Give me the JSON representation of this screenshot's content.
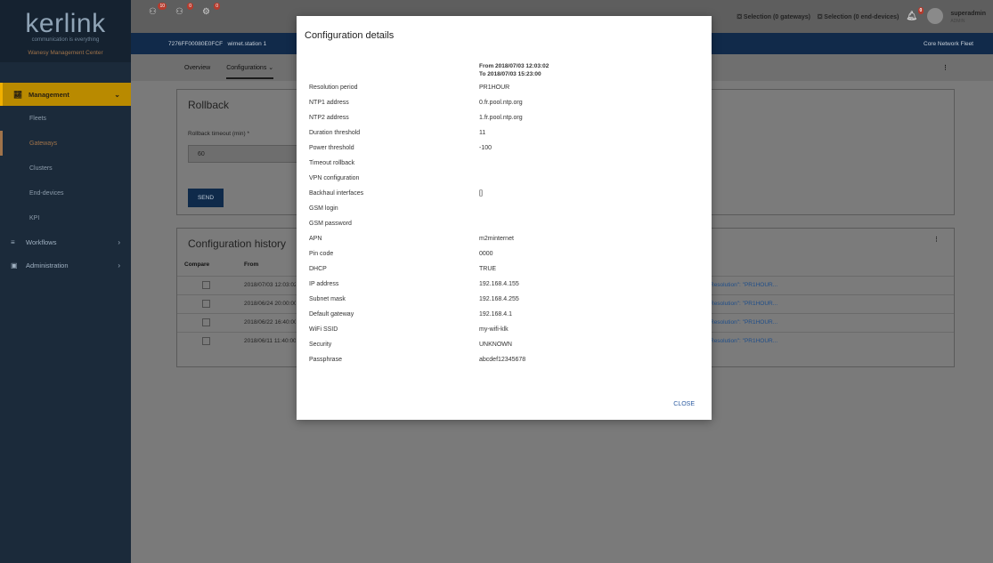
{
  "brand": {
    "logo": "kerlink",
    "tagline": "communication is everything",
    "product": "Wanesy Management Center"
  },
  "sidebar": {
    "management": {
      "label": "Management",
      "items": [
        "Fleets",
        "Gateways",
        "Clusters",
        "End-devices",
        "KPI"
      ],
      "active": "Gateways"
    },
    "workflows": "Workflows",
    "administration": "Administration"
  },
  "topbar": {
    "badges": [
      "10",
      "0",
      "0"
    ],
    "gw_selection": "Selection (0 gateways)",
    "ed_selection": "Selection (0 end-devices)",
    "notif_badge": "0",
    "user": "superadmin",
    "role": "ADMIN"
  },
  "bluebar": {
    "eui": "7276FF00080E0FCF",
    "name": "wirnet.station 1",
    "fleet": "Core Network Fleet"
  },
  "tabs": {
    "overview": "Overview",
    "configurations": "Configurations"
  },
  "rollback": {
    "title": "Rollback",
    "label": "Rollback timeout (min) *",
    "value": "60",
    "send": "SEND"
  },
  "history": {
    "title": "Configuration history",
    "headers": {
      "compare": "Compare",
      "from": "From"
    },
    "rows": [
      {
        "from": "2018/07/03 12:03:02",
        "config": "Resolution\": \"PR1HOUR..."
      },
      {
        "from": "2018/06/24 20:00:00",
        "config": "Resolution\": \"PR1HOUR..."
      },
      {
        "from": "2018/06/22 16:40:00",
        "config": "Resolution\": \"PR1HOUR..."
      },
      {
        "from": "2018/06/11 11:40:00",
        "config": "Resolution\": \"PR1HOUR..."
      }
    ]
  },
  "modal": {
    "title": "Configuration details",
    "from": "From 2018/07/03 12:03:02",
    "to": "To 2018/07/03 15:23:00",
    "rows": [
      {
        "k": "Resolution period",
        "v": "PR1HOUR"
      },
      {
        "k": "NTP1 address",
        "v": "0.fr.pool.ntp.org"
      },
      {
        "k": "NTP2 address",
        "v": "1.fr.pool.ntp.org"
      },
      {
        "k": "Duration threshold",
        "v": "11"
      },
      {
        "k": "Power threshold",
        "v": "-100"
      },
      {
        "k": "Timeout rollback",
        "v": ""
      },
      {
        "k": "VPN configuration",
        "v": ""
      },
      {
        "k": "Backhaul interfaces",
        "v": "[]"
      },
      {
        "k": "GSM login",
        "v": ""
      },
      {
        "k": "GSM password",
        "v": ""
      },
      {
        "k": "APN",
        "v": "m2minternet"
      },
      {
        "k": "Pin code",
        "v": "0000"
      },
      {
        "k": "DHCP",
        "v": "TRUE"
      },
      {
        "k": "IP address",
        "v": "192.168.4.155"
      },
      {
        "k": "Subnet mask",
        "v": "192.168.4.255"
      },
      {
        "k": "Default gateway",
        "v": "192.168.4.1"
      },
      {
        "k": "WiFi SSID",
        "v": "my-wifi-klk"
      },
      {
        "k": "Security",
        "v": "UNKNOWN"
      },
      {
        "k": "Passphrase",
        "v": "abcdef12345678"
      }
    ],
    "close": "CLOSE"
  }
}
